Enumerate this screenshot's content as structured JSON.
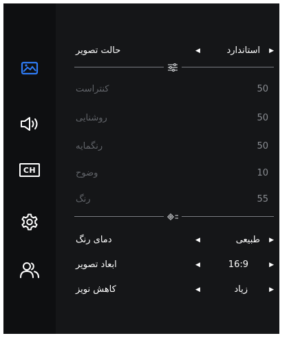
{
  "sidebar": {
    "items": [
      {
        "icon": "picture-icon",
        "active": true
      },
      {
        "icon": "speaker-icon",
        "active": false
      },
      {
        "icon": "ch-icon",
        "label": "CH",
        "active": false
      },
      {
        "icon": "gear-icon",
        "active": false
      },
      {
        "icon": "people-icon",
        "active": false
      }
    ]
  },
  "menu": {
    "picture_mode": {
      "label": "حالت تصویر",
      "value": "استاندارد"
    },
    "contrast": {
      "label": "کنتراست",
      "value": "50"
    },
    "brightness": {
      "label": "روشنایی",
      "value": "50"
    },
    "saturation": {
      "label": "رنگمایه",
      "value": "50"
    },
    "sharpness": {
      "label": "وضوح",
      "value": "10"
    },
    "color": {
      "label": "رنگ",
      "value": "55"
    },
    "color_temperature": {
      "label": "دمای رنگ",
      "value": "طبیعی"
    },
    "aspect_ratio": {
      "label": "ابعاد تصویر",
      "value": "16:9"
    },
    "noise_reduction": {
      "label": "کاهش نویز",
      "value": "زیاد"
    }
  },
  "colors": {
    "background": "#151618",
    "sidebar": "#0e0f11",
    "accent": "#2f7cf6",
    "dim_label": "#616469",
    "divider": "#7a7d82"
  }
}
